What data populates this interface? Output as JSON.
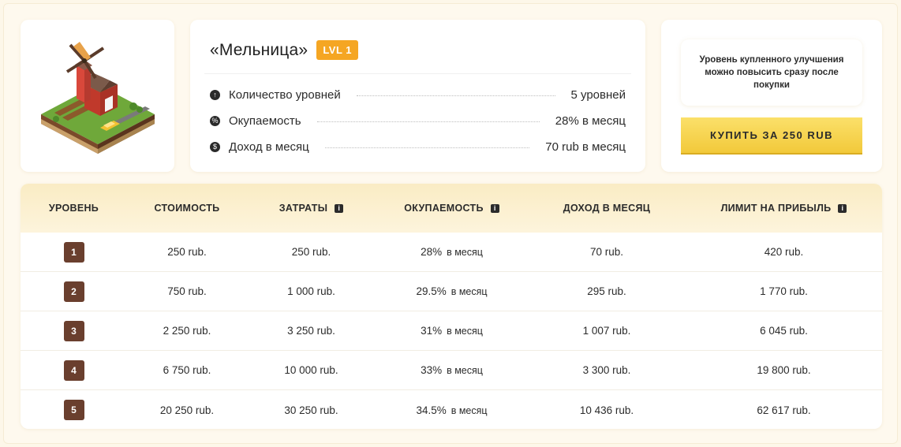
{
  "product": {
    "title": "«Мельница»",
    "level_badge": "LVL 1",
    "image_icon": "windmill-farm-illustration",
    "stats": [
      {
        "icon": "arrow-up-circle-icon",
        "glyph": "↑",
        "label": "Количество уровней",
        "value": "5 уровней"
      },
      {
        "icon": "percent-circle-icon",
        "glyph": "%",
        "label": "Окупаемость",
        "value": "28% в месяц"
      },
      {
        "icon": "dollar-circle-icon",
        "glyph": "$",
        "label": "Доход в месяц",
        "value": "70 rub в месяц"
      }
    ]
  },
  "buy": {
    "note": "Уровень купленного улучшения можно повысить сразу после покупки",
    "button_label": "КУПИТЬ ЗА 250 RUB"
  },
  "table": {
    "headers": [
      {
        "label": "УРОВЕНЬ",
        "info": false
      },
      {
        "label": "СТОИМОСТЬ",
        "info": false
      },
      {
        "label": "ЗАТРАТЫ",
        "info": true
      },
      {
        "label": "ОКУПАЕМОСТЬ",
        "info": true
      },
      {
        "label": "ДОХОД В МЕСЯЦ",
        "info": false
      },
      {
        "label": "ЛИМИТ НА ПРИБЫЛЬ",
        "info": true
      }
    ],
    "rows": [
      {
        "level": "1",
        "cost": "250 rub.",
        "expenses": "250 rub.",
        "payback": "28%",
        "payback_unit": "в месяц",
        "income": "70 rub.",
        "limit": "420 rub."
      },
      {
        "level": "2",
        "cost": "750 rub.",
        "expenses": "1 000 rub.",
        "payback": "29.5%",
        "payback_unit": "в месяц",
        "income": "295 rub.",
        "limit": "1 770 rub."
      },
      {
        "level": "3",
        "cost": "2 250 rub.",
        "expenses": "3 250 rub.",
        "payback": "31%",
        "payback_unit": "в месяц",
        "income": "1 007 rub.",
        "limit": "6 045 rub."
      },
      {
        "level": "4",
        "cost": "6 750 rub.",
        "expenses": "10 000 rub.",
        "payback": "33%",
        "payback_unit": "в месяц",
        "income": "3 300 rub.",
        "limit": "19 800 rub."
      },
      {
        "level": "5",
        "cost": "20 250 rub.",
        "expenses": "30 250 rub.",
        "payback": "34.5%",
        "payback_unit": "в месяц",
        "income": "10 436 rub.",
        "limit": "62 617 rub."
      }
    ]
  },
  "colors": {
    "accent": "#f5a623",
    "button": "#f2c93a",
    "level_chip": "#6a3f2e",
    "background": "#fdf7e9"
  }
}
